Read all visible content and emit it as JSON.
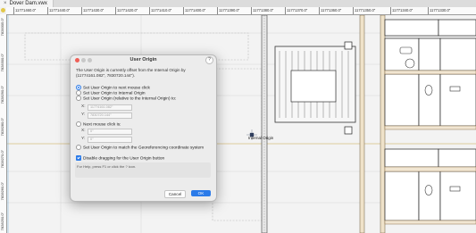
{
  "tab": {
    "close_glyph": "×",
    "title": "Dover Dam.vwx"
  },
  "ruler_top": [
    "11771460.0\"",
    "11771440.0\"",
    "11771430.0\"",
    "11771420.0\"",
    "11771410.0\"",
    "11771400.0\"",
    "11771390.0\"",
    "11771380.0\"",
    "11771370.0\"",
    "11771360.0\"",
    "11771350.0\"",
    "11771340.0\"",
    "11771330.0\""
  ],
  "ruler_left": [
    "7828305.0\"",
    "7828300.0\"",
    "7828290.0\"",
    "7828280.0\"",
    "7828270.0\"",
    "7828260.0\"",
    "7828250.0\""
  ],
  "canvas": {
    "origin_label": "Internal Origin"
  },
  "dialog": {
    "title": "User Origin",
    "help": "?",
    "description": "The User Origin is currently offset from the Internal Origin by (11774161.082\", 7830720.144\").",
    "opt_next_click": "Set User Origin to next mouse click",
    "opt_internal": "Set User Origin to Internal Origin",
    "opt_relative": "Set User Origin (relative to the Internal Origin) to:",
    "x_label": "X:",
    "y_label": "Y:",
    "rel_x": "11774161.082\"",
    "rel_y": "7830720.144\"",
    "opt_next_click_is": "Next mouse click is:",
    "next_x": "0\"",
    "next_y": "0\"",
    "opt_georef": "Set User Origin to match the Georeferencing coordinate system",
    "disable_drag": "Disable dragging for the User Origin button",
    "help_text": "For Help, press F1 or click the ? icon.",
    "cancel": "Cancel",
    "ok": "OK"
  }
}
